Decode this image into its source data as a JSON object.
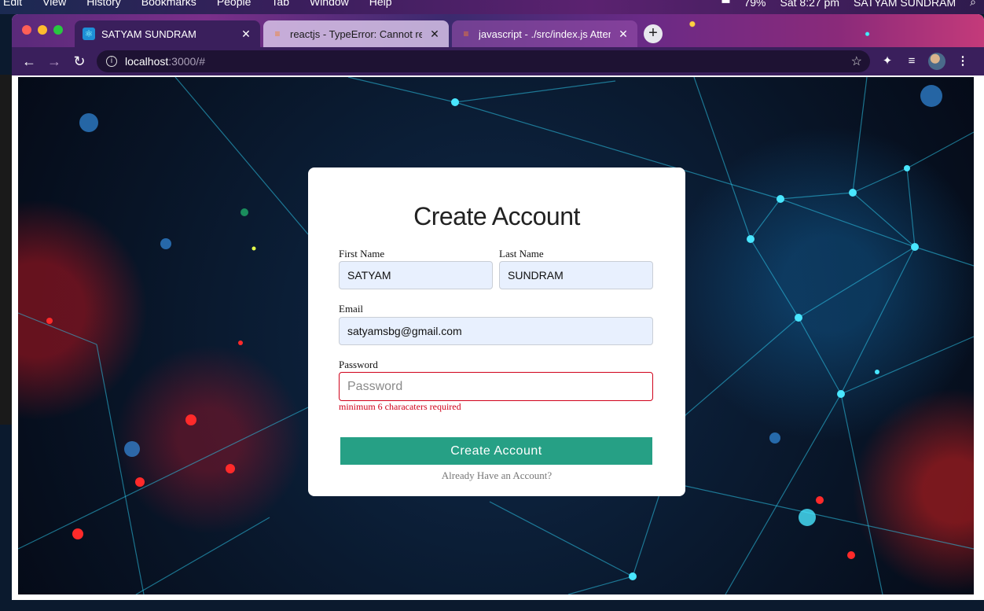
{
  "os_menubar": {
    "items": [
      "Edit",
      "View",
      "History",
      "Bookmarks",
      "People",
      "Tab",
      "Window",
      "Help"
    ],
    "battery": "79%",
    "clock": "Sat 8:27 pm",
    "user": "SATYAM SUNDRAM"
  },
  "browser": {
    "tabs": [
      {
        "title": "SATYAM SUNDRAM",
        "favicon": "react-icon",
        "active": true
      },
      {
        "title": "reactjs - TypeError: Cannot rea",
        "favicon": "stackoverflow-icon",
        "active": false
      },
      {
        "title": "javascript - ./src/index.js Attem",
        "favicon": "stackoverflow-icon",
        "active": false
      }
    ],
    "address": {
      "host": "localhost",
      "path": ":3000/#"
    }
  },
  "form": {
    "title": "Create Account",
    "first_name_label": "First Name",
    "first_name_value": "SATYAM",
    "last_name_label": "Last Name",
    "last_name_value": "SUNDRAM",
    "email_label": "Email",
    "email_value": "satyamsbg@gmail.com",
    "password_label": "Password",
    "password_placeholder": "Password",
    "password_error": "minimum 6 characaters required",
    "submit_label": "Create Account",
    "login_link": "Already Have an Account?"
  },
  "colors": {
    "submit_bg": "#26a085",
    "error": "#d0021b",
    "autofill_bg": "#e8f0fe",
    "browser_theme": "#3a1f5c"
  }
}
